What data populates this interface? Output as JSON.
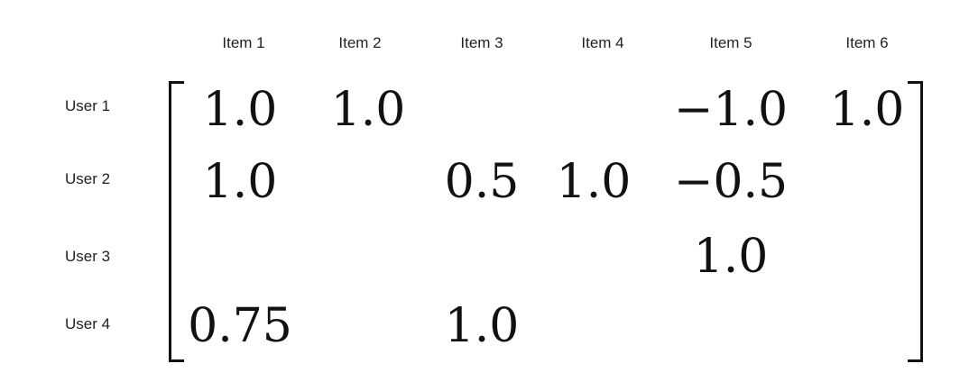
{
  "columns": [
    "Item 1",
    "Item 2",
    "Item 3",
    "Item 4",
    "Item 5",
    "Item 6"
  ],
  "rows": [
    "User 1",
    "User 2",
    "User 3",
    "User 4"
  ],
  "matrix": [
    [
      "1.0",
      "1.0",
      "",
      "",
      "−1.0",
      "1.0"
    ],
    [
      "1.0",
      "",
      "0.5",
      "1.0",
      "−0.5",
      ""
    ],
    [
      "",
      "",
      "",
      "",
      "1.0",
      ""
    ],
    [
      "0.75",
      "",
      "1.0",
      "",
      "",
      ""
    ]
  ]
}
